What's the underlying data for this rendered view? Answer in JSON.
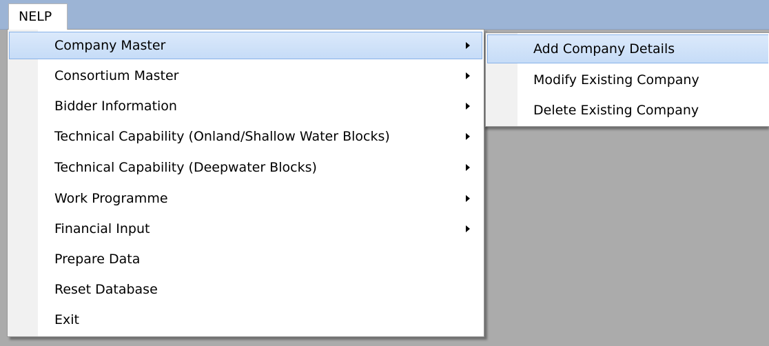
{
  "menubar": {
    "title": "NELP"
  },
  "main_menu": {
    "items": [
      {
        "label": "Company Master",
        "has_submenu": true,
        "highlighted": true
      },
      {
        "label": "Consortium Master",
        "has_submenu": true
      },
      {
        "label": "Bidder Information",
        "has_submenu": true
      },
      {
        "label": "Technical Capability (Onland/Shallow Water Blocks)",
        "has_submenu": true
      },
      {
        "label": "Technical Capability (Deepwater Blocks)",
        "has_submenu": true
      },
      {
        "label": "Work Programme",
        "has_submenu": true
      },
      {
        "label": "Financial Input",
        "has_submenu": true
      },
      {
        "label": "Prepare Data",
        "has_submenu": false
      },
      {
        "label": "Reset Database",
        "has_submenu": false
      },
      {
        "label": "Exit",
        "has_submenu": false
      }
    ]
  },
  "sub_menu": {
    "items": [
      {
        "label": "Add Company Details",
        "highlighted": true
      },
      {
        "label": "Modify Existing Company"
      },
      {
        "label": "Delete Existing Company"
      }
    ]
  },
  "colors": {
    "menubar": "#9cb4d5",
    "highlight": "#c6dcf7",
    "highlight_border": "#88b2e8",
    "background": "#ababab"
  },
  "icons": {
    "submenu_arrow": "chevron-right-icon"
  }
}
